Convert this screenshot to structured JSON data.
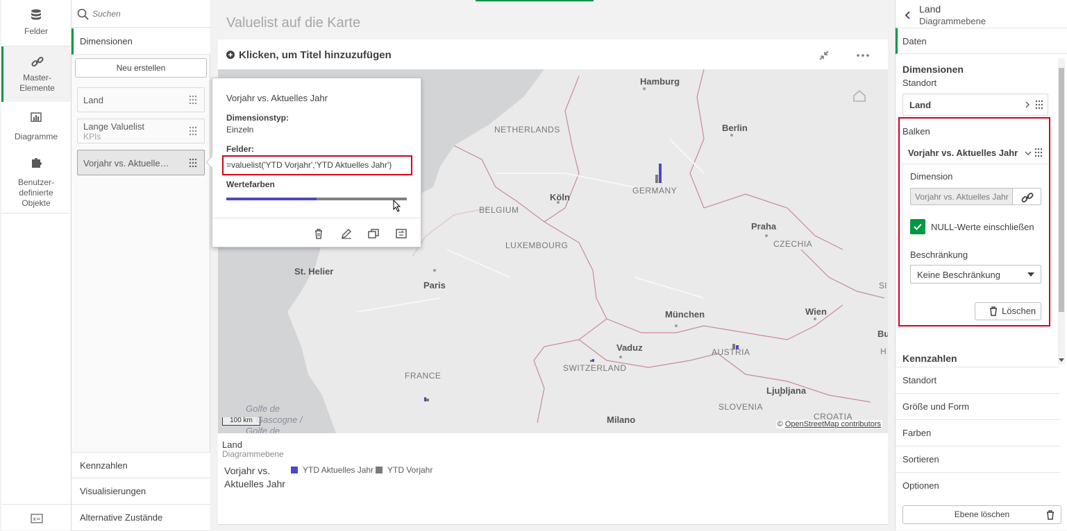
{
  "nav": {
    "items": [
      {
        "label": "Felder",
        "icon": "database-icon"
      },
      {
        "label": "Master-\nElemente",
        "icon": "link-icon"
      },
      {
        "label": "Diagramme",
        "icon": "bar-chart-icon"
      },
      {
        "label": "Benutzer-\ndefinierte\nObjekte",
        "icon": "puzzle-icon"
      }
    ],
    "bottom_icon": "variable-icon"
  },
  "assets": {
    "search_placeholder": "Suchen",
    "sections": {
      "dimensions": "Dimensionen",
      "measures": "Kennzahlen",
      "visualizations": "Visualisierungen",
      "alternate_states": "Alternative Zustände"
    },
    "new_button": "Neu erstellen",
    "items": [
      {
        "label": "Land",
        "sub": ""
      },
      {
        "label": "Lange Valuelist",
        "sub": "KPIs"
      },
      {
        "label": "Vorjahr vs. Aktuelle…",
        "sub": ""
      }
    ]
  },
  "sheet": {
    "title": "Valuelist auf die Karte"
  },
  "chart": {
    "title_placeholder": "Klicken, um Titel hinzuzufügen",
    "map": {
      "cities": [
        "Hamburg",
        "Berlin",
        "Köln",
        "Praha",
        "St. Helier",
        "Paris",
        "München",
        "Wien",
        "Vaduz",
        "Ljubljana",
        "Milano",
        "Bud",
        "Golfe de",
        "Gascogne /",
        "Golfe de"
      ],
      "countries": [
        "NETHERLANDS",
        "GERMANY",
        "BELGIUM",
        "LUXEMBOURG",
        "CZECHIA",
        "FRANCE",
        "SWITZERLAND",
        "AUSTRIA",
        "SLOVENIA",
        "CROATIA",
        "Sl",
        "H"
      ],
      "scale": "100 km",
      "attribution_prefix": "©",
      "attribution_link": "OpenStreetMap contributors"
    },
    "legend": {
      "layer": "Land",
      "layer_sub": "Diagrammebene",
      "dimension_line1": "Vorjahr vs.",
      "dimension_line2": "Aktuelles Jahr",
      "entries": [
        {
          "label": "YTD Aktuelles Jahr",
          "color": "#4f48c4"
        },
        {
          "label": "YTD Vorjahr",
          "color": "#7a7a7a"
        }
      ]
    }
  },
  "popup": {
    "title": "Vorjahr vs. Aktuelles Jahr",
    "type_label": "Dimensionstyp:",
    "type_value": "Einzeln",
    "fields_label": "Felder:",
    "fields_value": "=valuelist('YTD Vorjahr','YTD Aktuelles Jahr')",
    "colors_label": "Wertefarben",
    "color_bar": [
      "#4f48c4",
      "#808080"
    ],
    "actions": [
      "delete-icon",
      "edit-icon",
      "duplicate-icon",
      "replace-icon"
    ]
  },
  "props": {
    "header_title": "Land",
    "header_sub": "Diagrammebene",
    "tab": "Daten",
    "dimensions_title": "Dimensionen",
    "location_label": "Standort",
    "location_value": "Land",
    "bars_label": "Balken",
    "bars_value": "Vorjahr vs. Aktuelles Jahr",
    "dimension_label": "Dimension",
    "dimension_value": "Vorjahr vs. Aktuelles Jahr",
    "null_label": "NULL-Werte einschließen",
    "null_checked": true,
    "limit_label": "Beschränkung",
    "limit_value": "Keine Beschränkung",
    "delete_label": "Löschen",
    "measures_title": "Kennzahlen",
    "sections": [
      "Standort",
      "Größe und Form",
      "Farben",
      "Sortieren",
      "Optionen"
    ],
    "delete_layer": "Ebene löschen",
    "accent": "#009845",
    "highlight": "#d0021b"
  }
}
